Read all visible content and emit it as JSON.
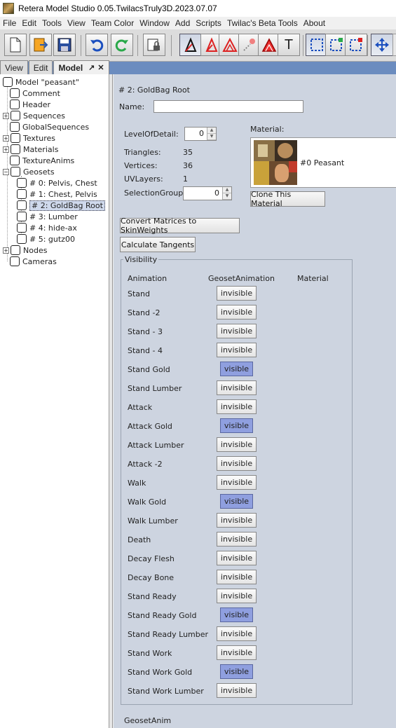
{
  "window": {
    "title": "Retera Model Studio 0.05.TwilacsTruly3D.2023.07.07"
  },
  "menubar": [
    {
      "label": "File"
    },
    {
      "label": "Edit"
    },
    {
      "label": "Tools"
    },
    {
      "label": "View"
    },
    {
      "label": "Team Color"
    },
    {
      "label": "Window"
    },
    {
      "label": "Add"
    },
    {
      "label": "Scripts"
    },
    {
      "label": "Twilac's Beta Tools"
    },
    {
      "label": "About"
    }
  ],
  "toolbar": {
    "icons": [
      "new-file-icon",
      "open-file-icon",
      "save-icon",
      "undo-icon",
      "redo-icon",
      "lock-icon",
      "select-pointer-icon",
      "vertex-tool-icon",
      "triangle-tool-icon",
      "paint-tool-icon",
      "face-tool-icon",
      "text-tool-icon",
      "select-box-icon",
      "select-add-icon",
      "select-remove-icon",
      "move-tool-icon"
    ],
    "text_tool_glyph": "T"
  },
  "tabs": [
    {
      "label": "View"
    },
    {
      "label": "Edit"
    },
    {
      "label": "Model",
      "active": true,
      "pin_glyph": "↗",
      "close_glyph": "✕"
    }
  ],
  "tree": {
    "root": "Model \"peasant\"",
    "items": [
      {
        "label": "Comment"
      },
      {
        "label": "Header"
      },
      {
        "label": "Sequences"
      },
      {
        "label": "GlobalSequences"
      },
      {
        "label": "Textures"
      },
      {
        "label": "Materials"
      },
      {
        "label": "TextureAnims"
      },
      {
        "label": "Geosets"
      },
      {
        "label": "# 0: Pelvis, Chest"
      },
      {
        "label": "# 1: Chest, Pelvis"
      },
      {
        "label": "# 2: GoldBag Root"
      },
      {
        "label": "# 3: Lumber"
      },
      {
        "label": "# 4: hide-ax"
      },
      {
        "label": "# 5: gutz00"
      },
      {
        "label": "Nodes"
      },
      {
        "label": "Cameras"
      }
    ],
    "expander_glyph": "+",
    "collapse_glyph": "−"
  },
  "panel": {
    "heading": "# 2: GoldBag Root",
    "name_label": "Name:",
    "name_value": "",
    "lod_label": "LevelOfDetail:",
    "lod_value": "0",
    "triangles_label": "Triangles:",
    "triangles_value": "35",
    "vertices_label": "Vertices:",
    "vertices_value": "36",
    "uvlayers_label": "UVLayers:",
    "uvlayers_value": "1",
    "selgroup_label": "SelectionGroup:",
    "selgroup_value": "0",
    "material_label": "Material:",
    "material_value": "#0 Peasant",
    "clone_material": "Clone This Material",
    "convert_matrices": "Convert Matrices to SkinWeights",
    "calculate_tangents": "Calculate Tangents",
    "visibility_title": "Visibility",
    "col_animation": "Animation",
    "col_geosetanim": "GeosetAnimation",
    "col_material": "Material",
    "footer_label": "GeosetAnim"
  },
  "visibility": [
    {
      "anim": "Stand",
      "state": "invisible"
    },
    {
      "anim": "Stand -2",
      "state": "invisible"
    },
    {
      "anim": "Stand - 3",
      "state": "invisible"
    },
    {
      "anim": "Stand - 4",
      "state": "invisible"
    },
    {
      "anim": "Stand Gold",
      "state": "visible"
    },
    {
      "anim": "Stand Lumber",
      "state": "invisible"
    },
    {
      "anim": "Attack",
      "state": "invisible"
    },
    {
      "anim": "Attack Gold",
      "state": "visible"
    },
    {
      "anim": "Attack Lumber",
      "state": "invisible"
    },
    {
      "anim": "Attack -2",
      "state": "invisible"
    },
    {
      "anim": "Walk",
      "state": "invisible"
    },
    {
      "anim": "Walk Gold",
      "state": "visible"
    },
    {
      "anim": "Walk Lumber",
      "state": "invisible"
    },
    {
      "anim": "Death",
      "state": "invisible"
    },
    {
      "anim": "Decay Flesh",
      "state": "invisible"
    },
    {
      "anim": "Decay Bone",
      "state": "invisible"
    },
    {
      "anim": "Stand Ready",
      "state": "invisible"
    },
    {
      "anim": "Stand Ready Gold",
      "state": "visible"
    },
    {
      "anim": "Stand Ready Lumber",
      "state": "invisible"
    },
    {
      "anim": "Stand Work",
      "state": "invisible"
    },
    {
      "anim": "Stand Work Gold",
      "state": "visible"
    },
    {
      "anim": "Stand Work Lumber",
      "state": "invisible"
    }
  ],
  "colors": {
    "panel_bg": "#cdd4e0",
    "visible_button": "#8f9fdf",
    "toolbar_strip": "#6b8cbf"
  }
}
